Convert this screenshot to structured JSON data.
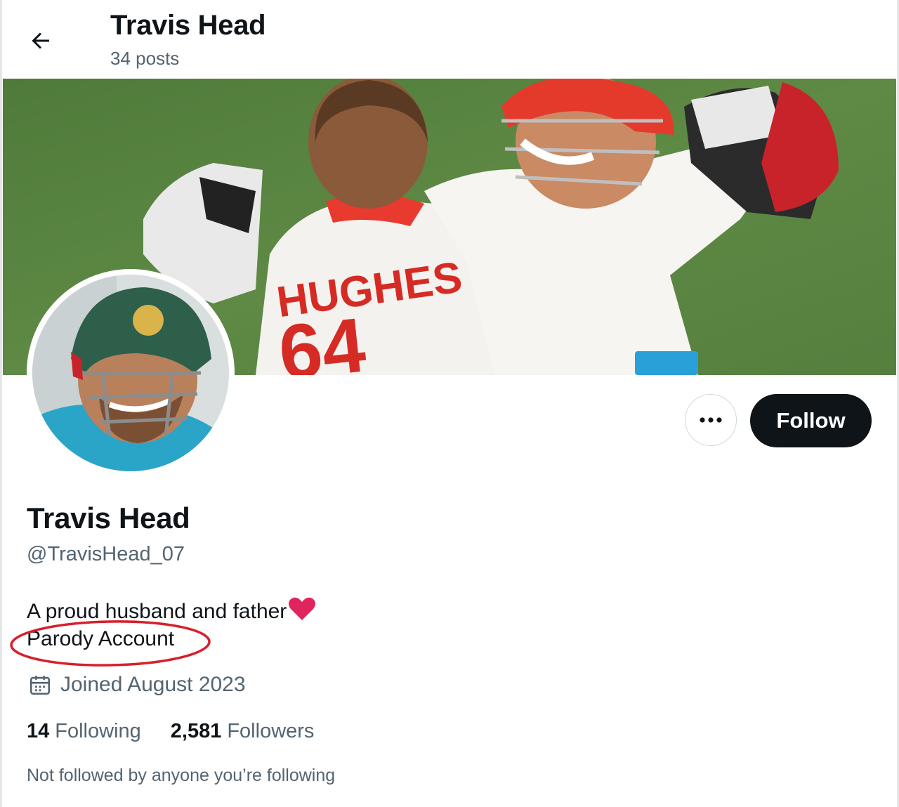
{
  "header": {
    "back_icon": "arrow-left-icon",
    "name": "Travis Head",
    "posts": "34 posts"
  },
  "banner": {
    "jersey_text": "HUGHES",
    "jersey_number": "64"
  },
  "actions": {
    "more_icon": "more-dots-icon",
    "follow_label": "Follow"
  },
  "profile": {
    "display_name": "Travis Head",
    "handle": "@TravisHead_07",
    "bio_line1": "A proud husband and father",
    "bio_emoji": "heart-icon",
    "bio_line2": "Parody Account",
    "joined_icon": "calendar-icon",
    "joined": "Joined August 2023",
    "following_count": "14",
    "following_label": "Following",
    "followers_count": "2,581",
    "followers_label": "Followers",
    "not_followed": "Not followed by anyone you’re following"
  },
  "colors": {
    "text_primary": "#0f1419",
    "text_secondary": "#536471",
    "follow_bg": "#0f1419",
    "heart": "#e0245e",
    "annotation": "#d6202a"
  }
}
